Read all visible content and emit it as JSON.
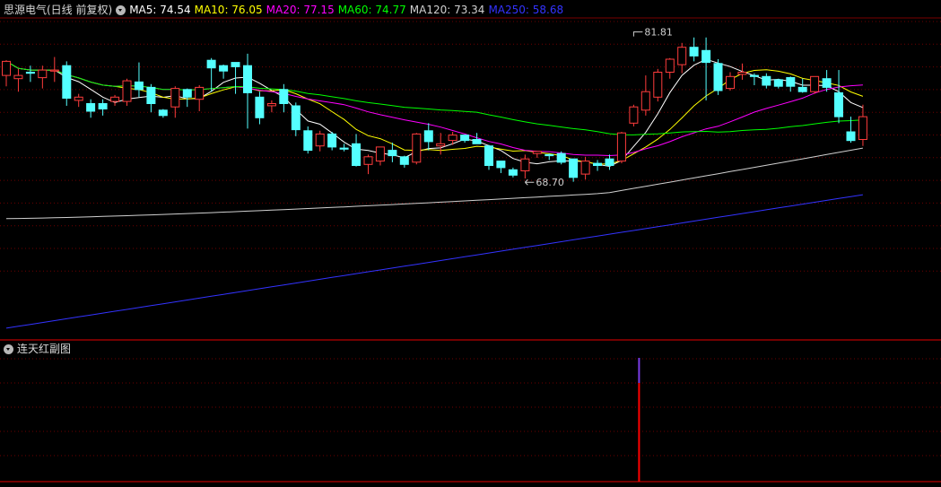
{
  "header": {
    "title": "思源电气(日线 前复权)",
    "ma_labels": [
      {
        "text": "MA5: 74.54",
        "color": "#ffffff"
      },
      {
        "text": "MA10: 76.05",
        "color": "#ffff00"
      },
      {
        "text": "MA20: 77.15",
        "color": "#ff00ff"
      },
      {
        "text": "MA60: 74.77",
        "color": "#00ff00"
      },
      {
        "text": "MA120: 73.34",
        "color": "#d0d0d0"
      },
      {
        "text": "MA250: 58.68",
        "color": "#3333ff"
      }
    ]
  },
  "subchart": {
    "title": "连天红副图"
  },
  "chart_data": [
    {
      "type": "candlestick",
      "title": "思源电气(日线 前复权)",
      "price_range": [
        54,
        83.6
      ],
      "annotations": [
        {
          "text": "81.81",
          "index": 52,
          "value": 81.81,
          "kind": "high"
        },
        {
          "text": "68.70",
          "index": 43,
          "value": 68.7,
          "kind": "low"
        }
      ],
      "colors": {
        "up": "#ff3c3c",
        "down": "#54ffff",
        "grid": "#6e0000",
        "frame": "#7a0000"
      },
      "grid": true,
      "candles": [
        [
          78.3,
          79.6,
          77.3,
          79.7
        ],
        [
          78.0,
          78.3,
          76.8,
          78.9
        ],
        [
          78.6,
          78.5,
          77.7,
          79.2
        ],
        [
          78.1,
          78.8,
          77.1,
          79.2
        ],
        [
          78.7,
          78.8,
          77.7,
          80.0
        ],
        [
          79.2,
          76.2,
          75.5,
          79.6
        ],
        [
          76.0,
          76.3,
          75.4,
          76.6
        ],
        [
          75.7,
          75.0,
          74.4,
          76.1
        ],
        [
          75.7,
          75.2,
          74.6,
          76.1
        ],
        [
          75.9,
          76.3,
          75.5,
          76.5
        ],
        [
          75.9,
          77.8,
          75.5,
          78.0
        ],
        [
          77.7,
          77.0,
          76.3,
          79.5
        ],
        [
          77.2,
          75.7,
          74.9,
          77.5
        ],
        [
          75.1,
          74.6,
          74.4,
          75.2
        ],
        [
          75.4,
          77.1,
          74.4,
          77.3
        ],
        [
          77.0,
          76.3,
          75.4,
          77.1
        ],
        [
          76.1,
          77.2,
          75.0,
          77.4
        ],
        [
          79.7,
          79.0,
          76.8,
          79.9
        ],
        [
          79.2,
          78.7,
          78.0,
          79.3
        ],
        [
          79.5,
          79.1,
          76.6,
          79.5
        ],
        [
          79.2,
          76.7,
          73.4,
          80.3
        ],
        [
          76.3,
          74.4,
          73.8,
          76.8
        ],
        [
          75.5,
          75.7,
          74.9,
          76.0
        ],
        [
          77.0,
          75.7,
          74.9,
          77.5
        ],
        [
          75.5,
          73.3,
          72.7,
          75.8
        ],
        [
          73.2,
          71.4,
          71.1,
          73.6
        ],
        [
          71.8,
          72.9,
          71.3,
          73.2
        ],
        [
          72.9,
          71.7,
          71.4,
          73.1
        ],
        [
          71.6,
          71.5,
          71.3,
          72.0
        ],
        [
          72.0,
          70.0,
          69.9,
          72.9
        ],
        [
          70.1,
          70.8,
          69.2,
          71.0
        ],
        [
          70.4,
          71.7,
          70.0,
          71.7
        ],
        [
          71.4,
          70.9,
          70.3,
          72.1
        ],
        [
          70.8,
          70.1,
          69.8,
          70.9
        ],
        [
          70.3,
          72.9,
          70.1,
          73.0
        ],
        [
          73.2,
          72.2,
          71.4,
          73.9
        ],
        [
          71.8,
          72.0,
          71.0,
          73.0
        ],
        [
          72.3,
          72.8,
          71.9,
          73.1
        ],
        [
          72.8,
          72.3,
          72.1,
          72.8
        ],
        [
          72.4,
          72.0,
          72.0,
          73.0
        ],
        [
          71.8,
          70.0,
          69.6,
          71.9
        ],
        [
          70.4,
          69.8,
          69.3,
          70.4
        ],
        [
          69.6,
          69.1,
          68.9,
          69.8
        ],
        [
          69.5,
          70.6,
          68.8,
          71.0
        ],
        [
          71.1,
          71.3,
          70.7,
          71.3
        ],
        [
          71.0,
          70.9,
          70.5,
          71.1
        ],
        [
          71.1,
          70.3,
          70.1,
          71.3
        ],
        [
          70.6,
          68.9,
          68.5,
          70.6
        ],
        [
          69.2,
          70.4,
          68.7,
          70.8
        ],
        [
          70.2,
          70.0,
          69.5,
          70.5
        ],
        [
          70.6,
          70.0,
          69.6,
          71.0
        ],
        [
          70.4,
          73.0,
          70.2,
          73.1
        ],
        [
          73.9,
          75.4,
          73.6,
          75.6
        ],
        [
          75.1,
          76.8,
          74.6,
          78.3
        ],
        [
          76.3,
          78.6,
          75.9,
          78.9
        ],
        [
          78.6,
          79.8,
          78.0,
          79.9
        ],
        [
          79.3,
          80.9,
          78.5,
          81.3
        ],
        [
          80.9,
          80.1,
          79.6,
          81.8
        ],
        [
          80.6,
          79.5,
          76.0,
          81.8
        ],
        [
          79.4,
          76.9,
          76.5,
          79.8
        ],
        [
          77.1,
          78.2,
          76.9,
          78.6
        ],
        [
          78.4,
          78.6,
          77.9,
          79.4
        ],
        [
          78.3,
          78.2,
          77.4,
          78.5
        ],
        [
          78.2,
          77.4,
          77.1,
          78.5
        ],
        [
          77.9,
          77.3,
          77.1,
          78.0
        ],
        [
          78.1,
          77.3,
          76.8,
          78.2
        ],
        [
          77.2,
          76.8,
          76.7,
          78.0
        ],
        [
          76.8,
          78.2,
          76.6,
          78.2
        ],
        [
          78.0,
          77.2,
          76.8,
          78.8
        ],
        [
          76.7,
          74.5,
          73.9,
          78.8
        ],
        [
          73.1,
          72.3,
          72.1,
          74.5
        ],
        [
          72.4,
          74.5,
          71.8,
          75.6
        ]
      ]
    },
    {
      "type": "bar",
      "title": "连天红副图",
      "bars": [
        {
          "index": 52,
          "value": 1.0,
          "colors": [
            "#ff0000",
            "#7a3ce6"
          ]
        }
      ]
    }
  ]
}
